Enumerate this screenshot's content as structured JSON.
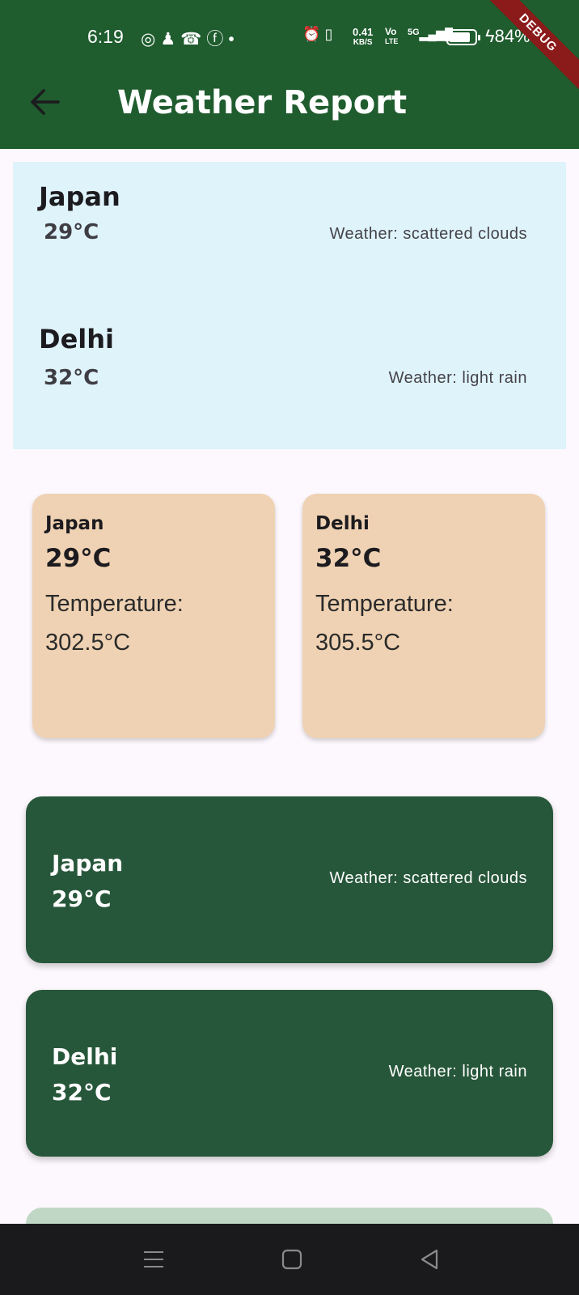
{
  "status_bar": {
    "time": "6:19",
    "notification_icons": [
      "whatsapp-icon",
      "snapchat-icon",
      "missed-call-icon",
      "facebook-icon",
      "dot-icon"
    ],
    "net_speed_value": "0.41",
    "net_speed_unit": "KB/S",
    "volte_top": "Vo",
    "volte_bottom": "LTE",
    "signal_label": "5G",
    "battery_percent": "84%",
    "battery_level": 0.84
  },
  "debug_banner": "DEBUG",
  "app_bar": {
    "title": "Weather Report",
    "back_icon": "arrow-left-icon"
  },
  "list_section": {
    "items": [
      {
        "city": "Japan",
        "temp": "29°C",
        "weather": "Weather: scattered clouds"
      },
      {
        "city": "Delhi",
        "temp": "32°C",
        "weather": "Weather: light rain"
      }
    ]
  },
  "grid_section": {
    "items": [
      {
        "city": "Japan",
        "temp": "29°C",
        "label": "Temperature:",
        "value": "302.5°C"
      },
      {
        "city": "Delhi",
        "temp": "32°C",
        "label": "Temperature:",
        "value": "305.5°C"
      }
    ]
  },
  "card_section": {
    "items": [
      {
        "city": "Japan",
        "temp": "29°C",
        "weather": "Weather: scattered clouds"
      },
      {
        "city": "Delhi",
        "temp": "32°C",
        "weather": "Weather: light rain"
      }
    ]
  },
  "nav_bar": {
    "icons": [
      "menu-icon",
      "home-icon",
      "back-triangle-icon"
    ]
  },
  "colors": {
    "app_bar": "#1f5c2e",
    "list_bg": "#dff3fb",
    "grid_card": "#efd2b3",
    "green_card": "#27573a",
    "partial_card": "#c1d7c5"
  }
}
